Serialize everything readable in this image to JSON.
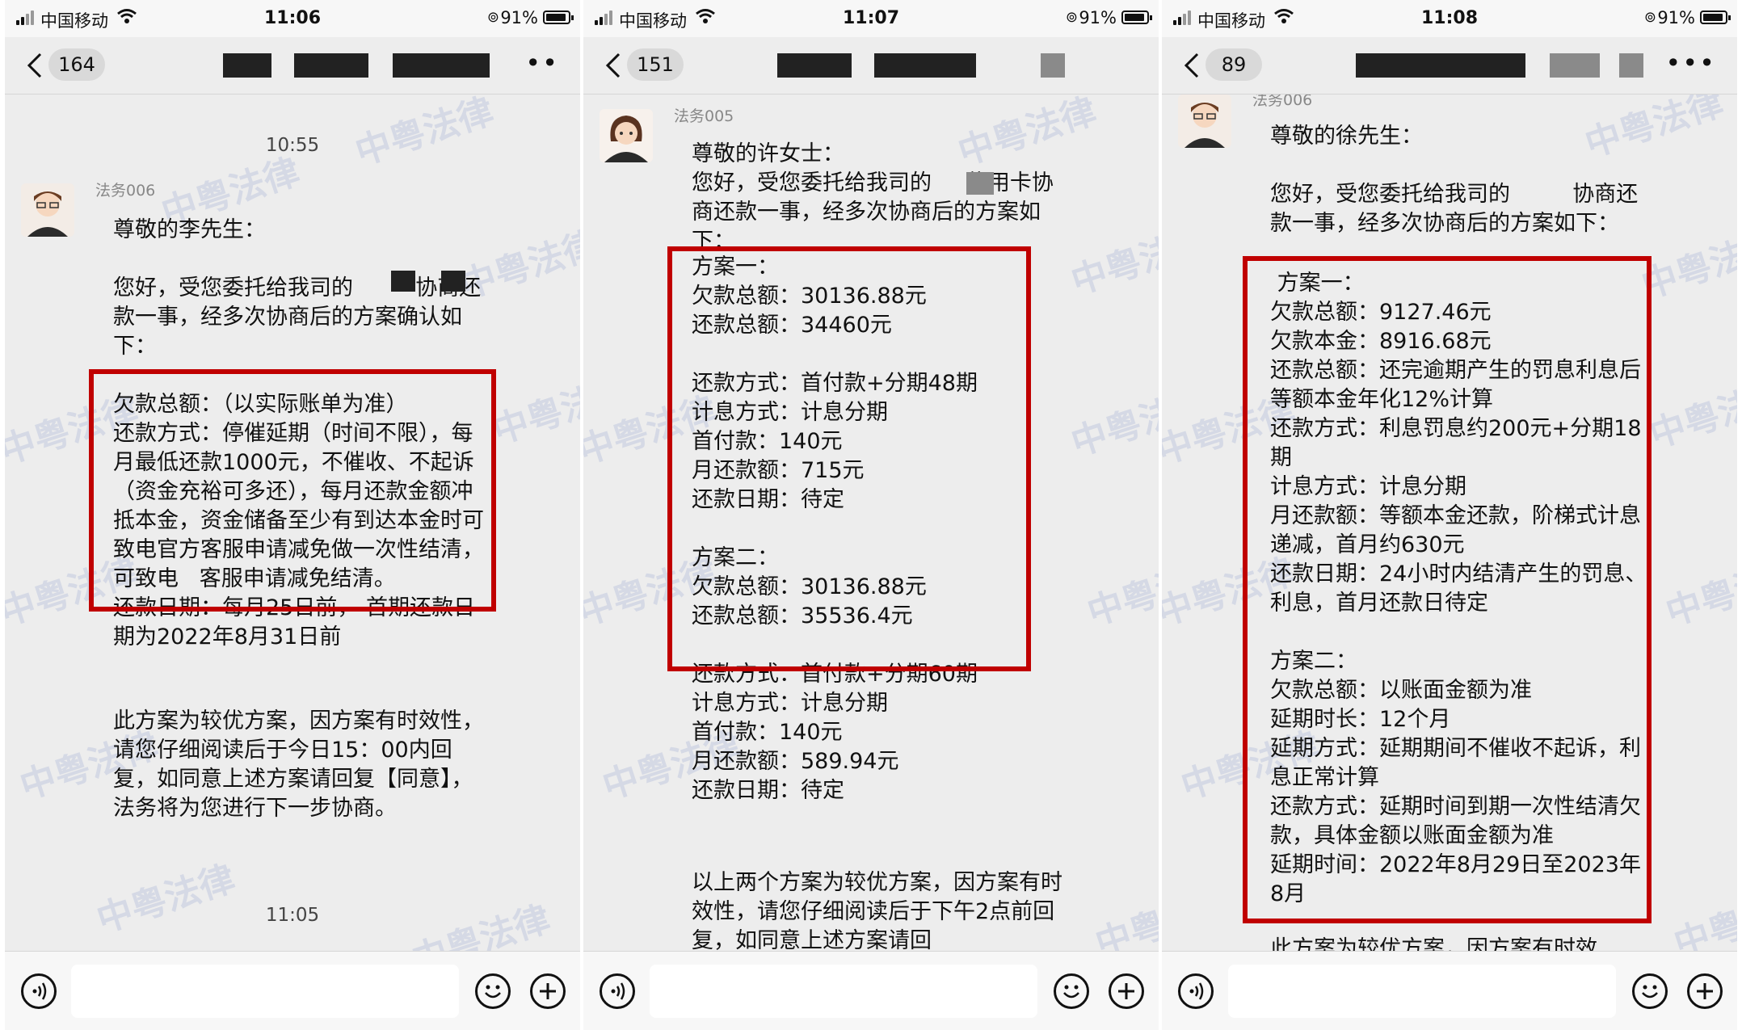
{
  "phones": [
    {
      "status": {
        "carrier": "中国移动",
        "time": "11:06",
        "battery": "91%"
      },
      "nav": {
        "badge": "164",
        "more": "••"
      },
      "watermark": "中粤法律",
      "timestamps": [
        "10:55",
        "11:05"
      ],
      "sender": "法务006",
      "greeting": "尊敬的李先生：",
      "intro": "您好，受您委托给我司的         协商还款一事，经多次协商后的方案确认如下：",
      "plan": "欠款总额：（以实际账单为准）\n还款方式：停催延期（时间不限），每月最低还款1000元，不催收、不起诉（资金充裕可多还），每月还款金额冲抵本金，资金储备至少有到达本金时可致电官方客服申请减免做一次性结清，可致电   客服申请减免结清。\n还款日期：每月25日前， 首期还款日期为2022年8月31日前",
      "closing": "此方案为较优方案，因方案有时效性，请您仔细阅读后于今日15：00内回复，如同意上述方案请回复【同意】，法务将为您进行下一步协商。"
    },
    {
      "status": {
        "carrier": "中国移动",
        "time": "11:07",
        "battery": "91%"
      },
      "nav": {
        "badge": "151"
      },
      "watermark": "中粤法律",
      "sender": "法务005",
      "greeting": "尊敬的许女士：",
      "intro": "您好，受您委托给我司的     信用卡协商还款一事，经多次协商后的方案如下：",
      "plan": "方案一：\n欠款总额：30136.88元\n还款总额：34460元\n\n还款方式：首付款+分期48期\n计息方式：计息分期\n首付款：140元\n月还款额：715元\n还款日期：待定\n\n方案二：\n欠款总额：30136.88元\n还款总额：35536.4元\n\n还款方式：首付款+分期60期\n计息方式：计息分期\n首付款：140元\n月还款额：589.94元\n还款日期：待定",
      "closing": "以上两个方案为较优方案，因方案有时效性，请您仔细阅读后于下午2点前回复，如同意上述方案请回"
    },
    {
      "status": {
        "carrier": "中国移动",
        "time": "11:08",
        "battery": "91%"
      },
      "nav": {
        "badge": "89",
        "more": "•••"
      },
      "watermark": "中粤法律",
      "sender": "法务006",
      "greeting": "尊敬的徐先生：",
      "intro": "您好，受您委托给我司的         协商还款一事，经多次协商后的方案如下：",
      "plan": " 方案一：\n欠款总额：9127.46元\n欠款本金：8916.68元\n还款总额：还完逾期产生的罚息利息后等额本金年化12%计算\n还款方式：利息罚息约200元+分期18期\n计息方式：计息分期\n月还款额：等额本金还款，阶梯式计息递减，首月约630元\n还款日期：24小时内结清产生的罚息、利息，首月还款日待定\n\n方案二：\n欠款总额：以账面金额为准\n延期时长：12个月\n延期方式：延期期间不催收不起诉，利息正常计算\n还款方式：延期时间到期一次性结清欠款，具体金额以账面金额为准\n延期时间：2022年8月29日至2023年8月",
      "closing": "此方案为较优方案，因方案有时效"
    }
  ]
}
